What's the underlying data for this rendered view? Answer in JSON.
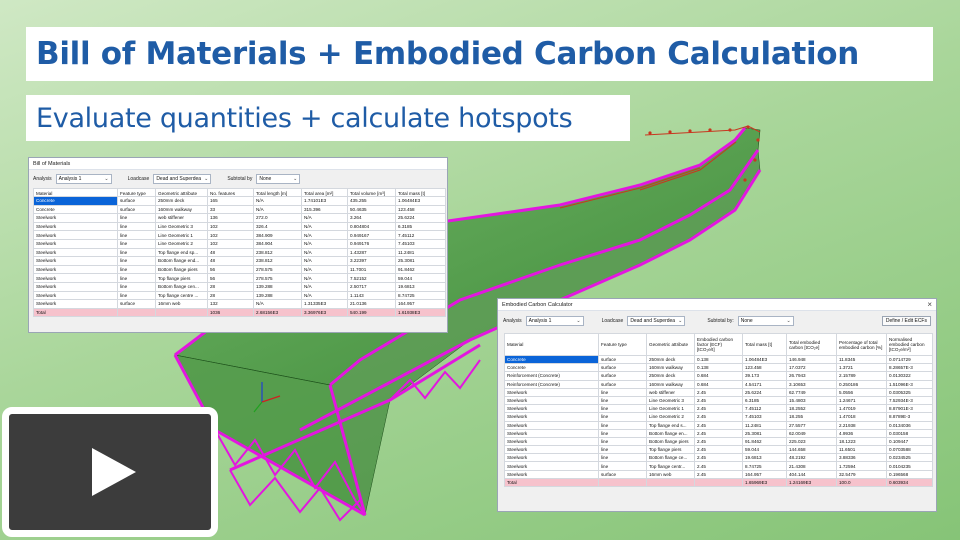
{
  "title": "Bill of Materials + Embodied Carbon Calculation",
  "subtitle": "Evaluate quantities + calculate hotspots",
  "colors": {
    "title_text": "#1f5ca6",
    "deck_green": "#3f9a3a",
    "steel_magenta": "#e316e0",
    "total_row": "#f6c2cc",
    "selected_row": "#0a64d8"
  },
  "play_button": {
    "icon": "play-icon"
  },
  "bom": {
    "window_title": "Bill of Materials",
    "analysis_label": "Analysis",
    "analysis_value": "Analysis 1",
    "loadcase_label": "Loadcase",
    "loadcase_value": "Dead and Superdea",
    "subtotal_label": "Subtotal by",
    "subtotal_value": "None",
    "columns": [
      "Material",
      "Feature type",
      "Geometric attribute",
      "No. features",
      "Total length [m]",
      "Total area [m²]",
      "Total volume [m³]",
      "Total mass [t]"
    ],
    "rows": [
      [
        "Concrete",
        "surface",
        "250mm deck",
        "165",
        "N/A",
        "1.74101E3",
        "435.255",
        "1.06484E3"
      ],
      [
        "Concrete",
        "surface",
        "160mm walkway",
        "33",
        "N/A",
        "315.396",
        "50.4635",
        "123.458"
      ],
      [
        "Steelwork",
        "line",
        "web stiffener",
        "136",
        "272.0",
        "N/A",
        "3.264",
        "25.6224"
      ],
      [
        "Steelwork",
        "line",
        "Line Geometric 3",
        "102",
        "326.4",
        "N/A",
        "0.804804",
        "6.3185"
      ],
      [
        "Steelwork",
        "line",
        "Line Geometric 1",
        "102",
        "384.909",
        "N/A",
        "0.949167",
        "7.45112"
      ],
      [
        "Steelwork",
        "line",
        "Line Geometric 2",
        "102",
        "384.904",
        "N/A",
        "0.949176",
        "7.45103"
      ],
      [
        "Steelwork",
        "line",
        "Top flange end sp...",
        "48",
        "238.812",
        "N/A",
        "1.43287",
        "11.2481"
      ],
      [
        "Steelwork",
        "line",
        "Bottom flange end...",
        "48",
        "238.812",
        "N/A",
        "3.22397",
        "25.3081"
      ],
      [
        "Steelwork",
        "line",
        "Bottom flange piers",
        "56",
        "278.575",
        "N/A",
        "11.7001",
        "91.8462"
      ],
      [
        "Steelwork",
        "line",
        "Top flange piers",
        "56",
        "278.575",
        "N/A",
        "7.52152",
        "59.044"
      ],
      [
        "Steelwork",
        "line",
        "Bottom flange cen...",
        "28",
        "139.288",
        "N/A",
        "2.50717",
        "19.6813"
      ],
      [
        "Steelwork",
        "line",
        "Top flange centre ...",
        "28",
        "139.288",
        "N/A",
        "1.1143",
        "8.74725"
      ],
      [
        "Steelwork",
        "surface",
        "16mm web",
        "132",
        "N/A",
        "1.31335E3",
        "21.0136",
        "164.957"
      ]
    ],
    "total": [
      "Total",
      "",
      "",
      "1036",
      "2.68156E3",
      "3.36976E3",
      "540.199",
      "1.61938E3"
    ]
  },
  "ecc": {
    "window_title": "Embodied Carbon Calculator",
    "analysis_label": "Analysis",
    "analysis_value": "Analysis 1",
    "loadcase_label": "Loadcase",
    "loadcase_value": "Dead and Superdea",
    "subtotal_label": "Subtotal by:",
    "subtotal_value": "None",
    "define_button": "Define / Edit ECFs",
    "columns": [
      "Material",
      "Feature type",
      "Geometric attribute",
      "Embodied carbon factor (ECF) [tCO₂e/t]",
      "Total mass [t]",
      "Total embodied carbon [tCO₂e]",
      "Percentage of total embodied carbon [%]",
      "Normalised embodied carbon [tCO₂e/m²]"
    ],
    "rows": [
      [
        "Concrete",
        "surface",
        "250mm deck",
        "0.138",
        "1.06484E3",
        "146.948",
        "11.8345",
        "0.0714729"
      ],
      [
        "Concrete",
        "surface",
        "160mm walkway",
        "0.138",
        "123.458",
        "17.0372",
        "1.3721",
        "8.28657E-3"
      ],
      [
        "Reinforcement (Concrete)",
        "surface",
        "250mm deck",
        "0.684",
        "39.173",
        "26.7943",
        "2.15789",
        "0.0130322"
      ],
      [
        "Reinforcement (Concrete)",
        "surface",
        "160mm walkway",
        "0.684",
        "4.54171",
        "3.10653",
        "0.250186",
        "1.51096E-3"
      ],
      [
        "Steelwork",
        "line",
        "web stiffener",
        "2.45",
        "25.6224",
        "62.7749",
        "5.0556",
        "0.0305325"
      ],
      [
        "Steelwork",
        "line",
        "Line Geometric 3",
        "2.45",
        "6.3185",
        "15.4803",
        "1.24671",
        "7.52934E-3"
      ],
      [
        "Steelwork",
        "line",
        "Line Geometric 1",
        "2.45",
        "7.45112",
        "18.2552",
        "1.47019",
        "8.87901E-3"
      ],
      [
        "Steelwork",
        "line",
        "Line Geometric 2",
        "2.45",
        "7.45103",
        "18.255",
        "1.47018",
        "8.8789E-3"
      ],
      [
        "Steelwork",
        "line",
        "Top flange end s...",
        "2.45",
        "11.2481",
        "27.5577",
        "2.21938",
        "0.0134036"
      ],
      [
        "Steelwork",
        "line",
        "Bottom flange en...",
        "2.45",
        "25.3081",
        "62.0049",
        "4.9936",
        "0.030158"
      ],
      [
        "Steelwork",
        "line",
        "Bottom flange piers",
        "2.45",
        "91.8462",
        "225.023",
        "18.1223",
        "0.109447"
      ],
      [
        "Steelwork",
        "line",
        "Top flange piers",
        "2.45",
        "59.044",
        "144.658",
        "11.6501",
        "0.0703588"
      ],
      [
        "Steelwork",
        "line",
        "Bottom flange ce...",
        "2.45",
        "19.6813",
        "48.2192",
        "3.88336",
        "0.0234525"
      ],
      [
        "Steelwork",
        "line",
        "Top flange centr...",
        "2.45",
        "8.74725",
        "21.4308",
        "1.72594",
        "0.0104235"
      ],
      [
        "Steelwork",
        "surface",
        "16mm web",
        "2.45",
        "164.957",
        "404.144",
        "32.5479",
        "0.196568"
      ]
    ],
    "total": [
      "Total",
      "",
      "",
      "",
      "1.65969E3",
      "1.24169E3",
      "100.0",
      "0.603934"
    ]
  }
}
